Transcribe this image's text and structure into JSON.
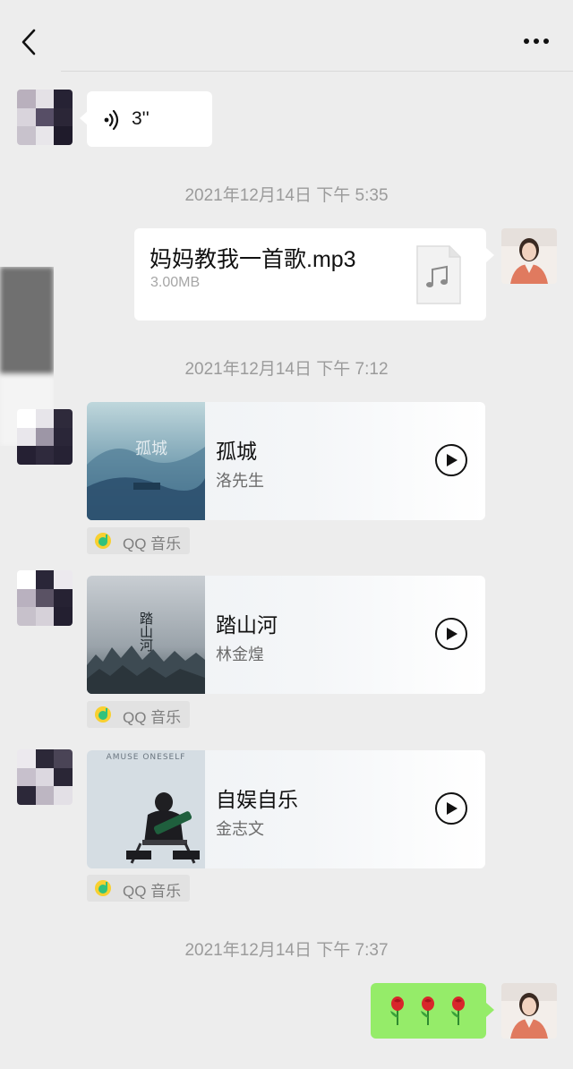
{
  "header": {
    "back_icon": "chevron-left-icon",
    "more_icon": "more-dots-icon"
  },
  "messages": {
    "voice": {
      "duration": "3''",
      "icon": "voice-wave-icon"
    },
    "timestamp_1": "2021年12月14日 下午 5:35",
    "file": {
      "name": "妈妈教我一首歌.mp3",
      "size": "3.00MB",
      "icon": "music-file-icon"
    },
    "timestamp_2": "2021年12月14日 下午 7:12",
    "music_cards": [
      {
        "title": "孤城",
        "artist": "洛先生",
        "cover_text": "孤城",
        "source": "QQ 音乐"
      },
      {
        "title": "踏山河",
        "artist": "林金煌",
        "cover_text": "踏山河",
        "source": "QQ 音乐"
      },
      {
        "title": "自娱自乐",
        "artist": "金志文",
        "cover_text": "AMUSE ONESELF",
        "source": "QQ 音乐"
      }
    ],
    "timestamp_3": "2021年12月14日 下午 7:37",
    "emoji_reply": {
      "content": "🌹🌹🌹",
      "icon": "rose-emoji-icon"
    }
  },
  "colors": {
    "background": "#ededed",
    "sent_bubble": "#95ec69",
    "received_bubble": "#ffffff",
    "timestamp_text": "#9b9b9b"
  }
}
